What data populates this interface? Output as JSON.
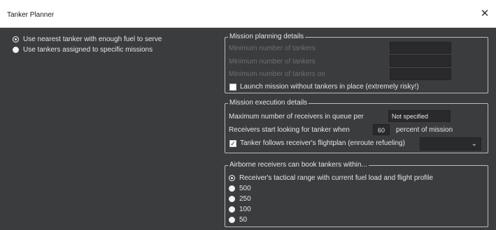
{
  "window": {
    "title": "Tanker Planner",
    "close_glyph": "✕"
  },
  "left_options": [
    {
      "label": "Use nearest tanker with enough fuel to serve",
      "selected": true
    },
    {
      "label": "Use tankers assigned to specific missions",
      "selected": false
    }
  ],
  "mission_planning": {
    "title": "Mission planning details",
    "min_tankers_label": "Minimum number of tankers",
    "min_tankers_2_label": "Minimum number of tankers",
    "min_tankers_on_label": "Minimum number of tankers on",
    "launch_without_label": "Launch mission without tankers in place (extremely risky!)",
    "launch_without_checked": false
  },
  "mission_execution": {
    "title": "Mission execution details",
    "max_receivers_label": "Maximum number of receivers in queue per",
    "max_receivers_value": "Not specified",
    "receivers_start_label": "Receivers start looking for tanker when",
    "receivers_start_value": "60",
    "percent_label": "percent of mission",
    "follows_flightplan_label": "Tanker follows receiver's flightplan (enroute refueling)",
    "follows_flightplan_checked": true,
    "check_glyph": "✓",
    "chevron_glyph": "⌄"
  },
  "airborne": {
    "title": "Airborne receivers can book tankers within...",
    "options": [
      {
        "label": "Receiver's tactical range with current fuel load and flight profile",
        "selected": true
      },
      {
        "label": "500",
        "selected": false
      },
      {
        "label": "250",
        "selected": false
      },
      {
        "label": "100",
        "selected": false
      },
      {
        "label": "50",
        "selected": false
      }
    ]
  }
}
